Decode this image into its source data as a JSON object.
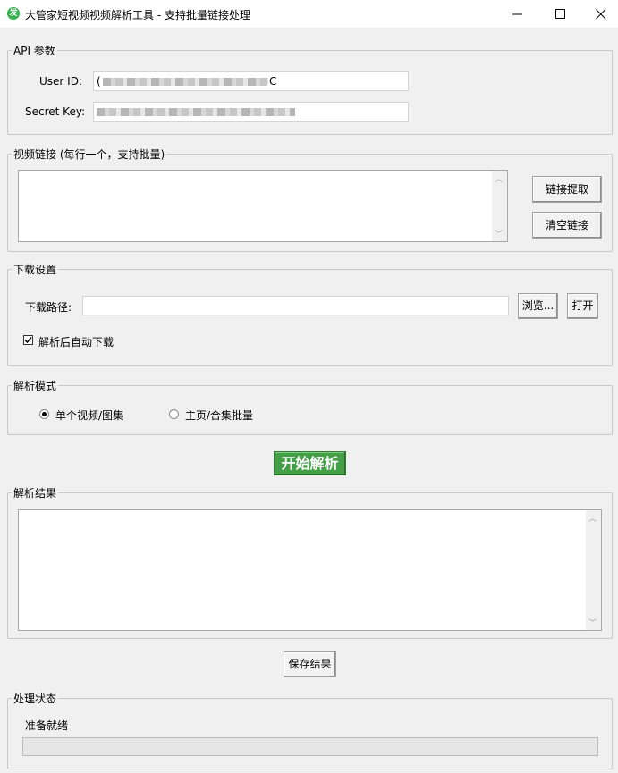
{
  "window": {
    "title": "大管家短视频视频解析工具 - 支持批量链接处理",
    "icon_glyph": "发",
    "icon_color": "#2fb34a"
  },
  "api": {
    "legend": "API 参数",
    "user_id_label": "User ID:",
    "secret_key_label": "Secret Key:",
    "user_id_prefix": "(",
    "user_id_suffix": "C"
  },
  "links": {
    "legend": "视频链接 (每行一个，支持批量)",
    "extract_button": "链接提取",
    "clear_button": "清空链接"
  },
  "download": {
    "legend": "下载设置",
    "path_label": "下载路径:",
    "path_value": "",
    "browse_button": "浏览...",
    "open_button": "打开",
    "auto_download_label": "解析后自动下载",
    "auto_download_checked": true
  },
  "mode": {
    "legend": "解析模式",
    "options": [
      "单个视频/图集",
      "主页/合集批量"
    ],
    "selected_index": 0
  },
  "start_button": "开始解析",
  "start_button_color": "#43a047",
  "results": {
    "legend": "解析结果",
    "save_button": "保存结果"
  },
  "status": {
    "legend": "处理状态",
    "text": "准备就绪",
    "progress": 0
  }
}
